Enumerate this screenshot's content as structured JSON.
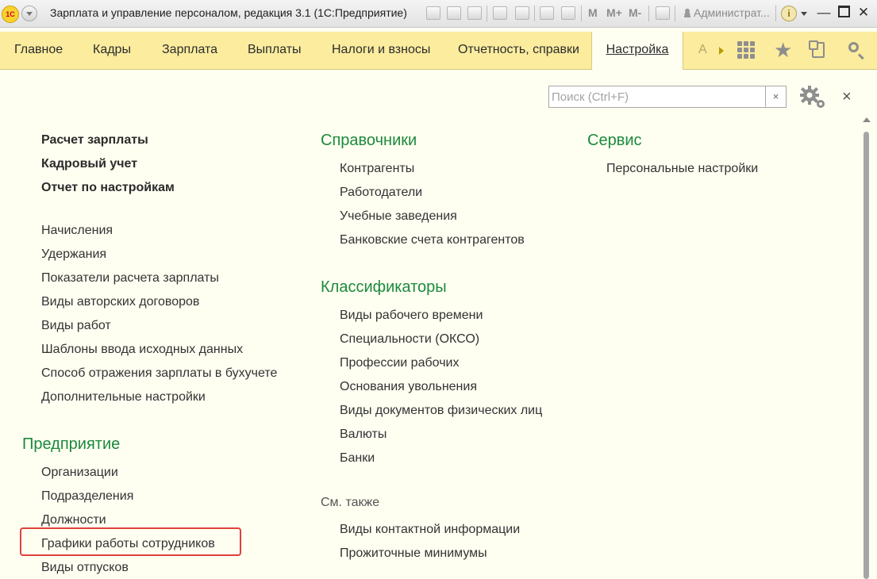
{
  "window": {
    "title": "Зарплата и управление персоналом, редакция 3.1  (1С:Предприятие)",
    "logo_text": "1С",
    "user": "Администрат...",
    "toolbar_text_icons": [
      "M",
      "M+",
      "M-"
    ]
  },
  "sections": {
    "items": [
      "Главное",
      "Кадры",
      "Зарплата",
      "Выплаты",
      "Налоги и взносы",
      "Отчетность, справки"
    ],
    "active": "Настройка",
    "more": "А"
  },
  "search": {
    "placeholder": "Поиск (Ctrl+F)",
    "value": "",
    "clear_label": "×"
  },
  "close_label": "×",
  "columns": {
    "left": {
      "bold_links": [
        "Расчет зарплаты",
        "Кадровый учет",
        "Отчет по настройкам"
      ],
      "links": [
        "Начисления",
        "Удержания",
        "Показатели расчета зарплаты",
        "Виды авторских договоров",
        "Виды работ",
        "Шаблоны ввода исходных данных",
        "Способ отражения зарплаты в бухучете",
        "Дополнительные настройки"
      ],
      "group_title": "Предприятие",
      "group_links": [
        "Организации",
        "Подразделения",
        "Должности",
        "Графики работы сотрудников",
        "Виды отпусков"
      ]
    },
    "middle": {
      "group1_title": "Справочники",
      "group1_links": [
        "Контрагенты",
        "Работодатели",
        "Учебные заведения",
        "Банковские счета контрагентов"
      ],
      "group2_title": "Классификаторы",
      "group2_links": [
        "Виды рабочего времени",
        "Специальности (ОКСО)",
        "Профессии рабочих",
        "Основания увольнения",
        "Виды документов физических лиц",
        "Валюты",
        "Банки"
      ],
      "see_also_title": "См. также",
      "see_also_links": [
        "Виды контактной информации",
        "Прожиточные минимумы"
      ]
    },
    "right": {
      "group_title": "Сервис",
      "group_links": [
        "Персональные настройки"
      ]
    }
  },
  "colors": {
    "section_bar": "#fbec9e",
    "content_bg": "#fefef1",
    "group_title": "#1c8a3c",
    "highlight": "#e0413b"
  }
}
